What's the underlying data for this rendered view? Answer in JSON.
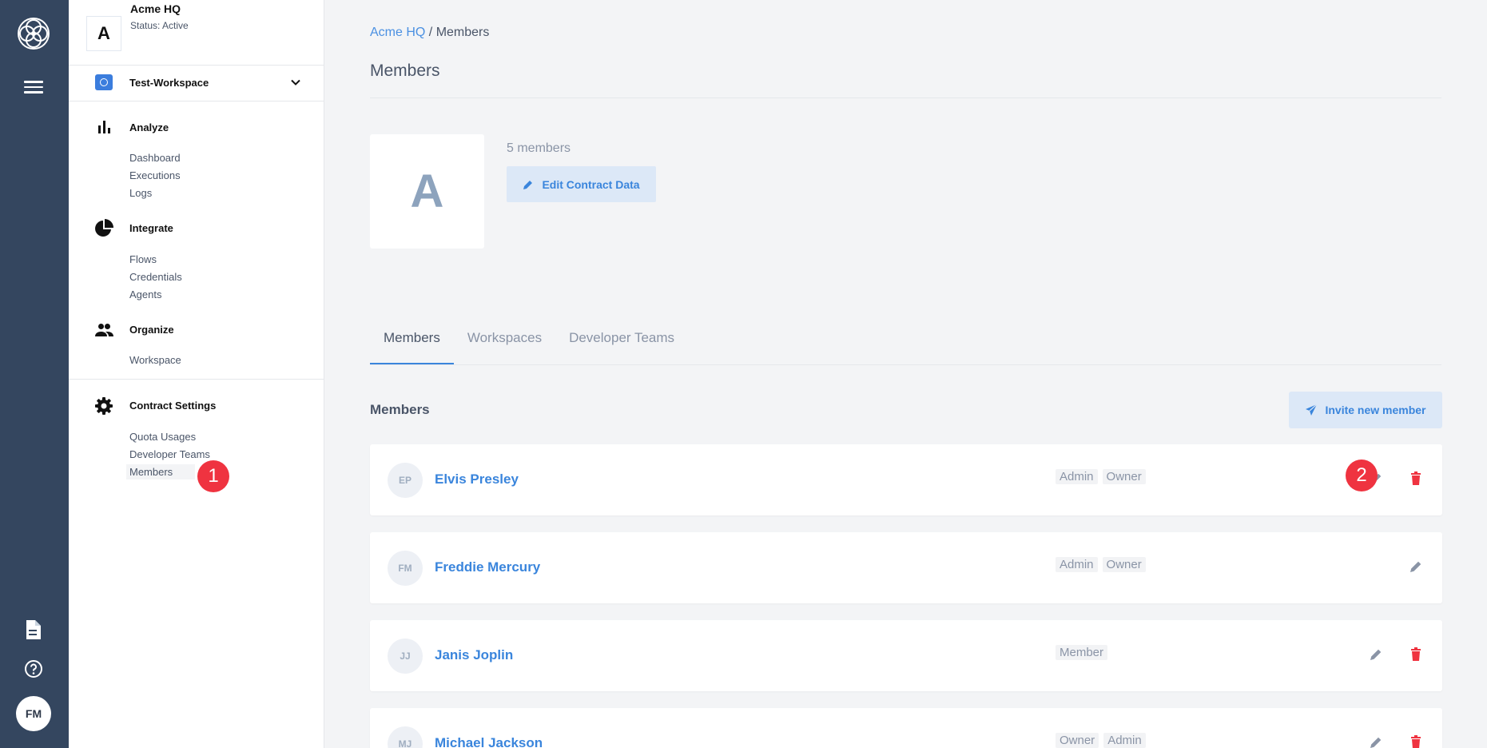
{
  "rail": {
    "avatar_initials": "FM"
  },
  "org": {
    "initial": "A",
    "name": "Acme HQ",
    "status": "Status: Active"
  },
  "workspace": {
    "label": "Test-Workspace"
  },
  "nav": {
    "analyze": {
      "title": "Analyze",
      "items": [
        "Dashboard",
        "Executions",
        "Logs"
      ]
    },
    "integrate": {
      "title": "Integrate",
      "items": [
        "Flows",
        "Credentials",
        "Agents"
      ]
    },
    "organize": {
      "title": "Organize",
      "items": [
        "Workspace"
      ]
    },
    "contract": {
      "title": "Contract Settings",
      "items": [
        "Quota Usages",
        "Developer Teams",
        "Members"
      ]
    }
  },
  "badges": [
    "1",
    "2"
  ],
  "breadcrumb": {
    "org": "Acme HQ",
    "sep": " / ",
    "current": "Members"
  },
  "page_title": "Members",
  "summary": {
    "avatar_initial": "A",
    "count": "5 members",
    "edit_label": "Edit Contract Data"
  },
  "tabs": [
    "Members",
    "Workspaces",
    "Developer Teams"
  ],
  "members_section": {
    "label": "Members",
    "invite_label": "Invite new member"
  },
  "members": [
    {
      "initials": "EP",
      "name": "Elvis Presley",
      "roles": [
        "Admin",
        "Owner"
      ],
      "can_delete": true
    },
    {
      "initials": "FM",
      "name": "Freddie Mercury",
      "roles": [
        "Admin",
        "Owner"
      ],
      "can_delete": false
    },
    {
      "initials": "JJ",
      "name": "Janis Joplin",
      "roles": [
        "Member"
      ],
      "can_delete": true
    },
    {
      "initials": "MJ",
      "name": "Michael Jackson",
      "roles": [
        "Owner",
        "Admin"
      ],
      "can_delete": true
    }
  ],
  "colors": {
    "rail": "#34465f",
    "accent": "#3a85dc",
    "danger": "#ef3340",
    "badge": "#ef3340"
  }
}
